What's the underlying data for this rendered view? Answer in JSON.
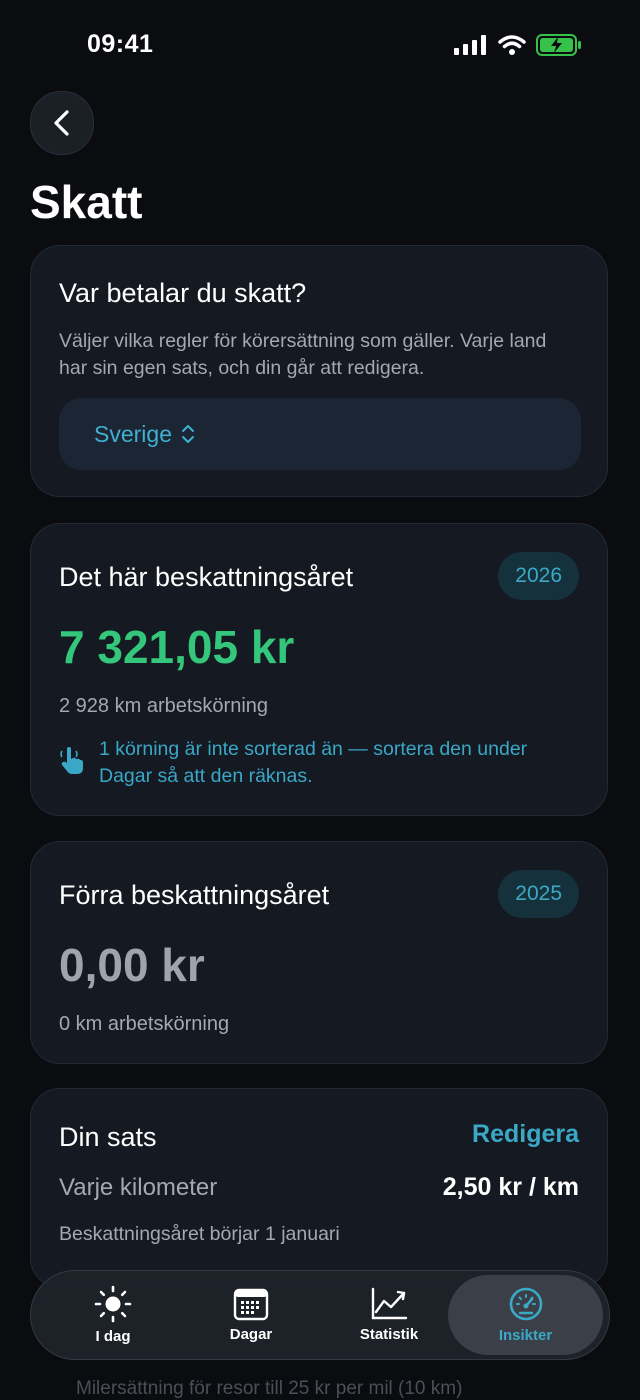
{
  "status_bar": {
    "time": "09:41"
  },
  "header": {
    "title": "Skatt"
  },
  "country_card": {
    "title": "Var betalar du skatt?",
    "description": "Väljer vilka regler för körersättning som gäller. Varje land har sin egen sats, och din går att redigera.",
    "selected_country": "Sverige"
  },
  "current_year_card": {
    "title": "Det här beskattningsåret",
    "year": "2026",
    "amount": "7 321,05 kr",
    "distance": "2 928 km arbetskörning",
    "hint": "1 körning är inte sorterad än — sortera den under Dagar så att den räknas.",
    "accent_color": "#34c77b"
  },
  "previous_year_card": {
    "title": "Förra beskattningsåret",
    "year": "2025",
    "amount": "0,00 kr",
    "distance": "0 km arbetskörning"
  },
  "rate_card": {
    "title": "Din sats",
    "edit_label": "Redigera",
    "rate_label": "Varje kilometer",
    "rate_value": "2,50 kr / km",
    "note": "Beskattningsåret börjar 1 januari"
  },
  "below_content": {
    "text": "Milersättning för resor till 25 kr per mil (10 km)"
  },
  "tabbar": {
    "tabs": [
      {
        "label": "I dag",
        "icon": "sun-icon"
      },
      {
        "label": "Dagar",
        "icon": "calendar-icon"
      },
      {
        "label": "Statistik",
        "icon": "chart-icon"
      },
      {
        "label": "Insikter",
        "icon": "gauge-icon",
        "active": true
      }
    ]
  }
}
